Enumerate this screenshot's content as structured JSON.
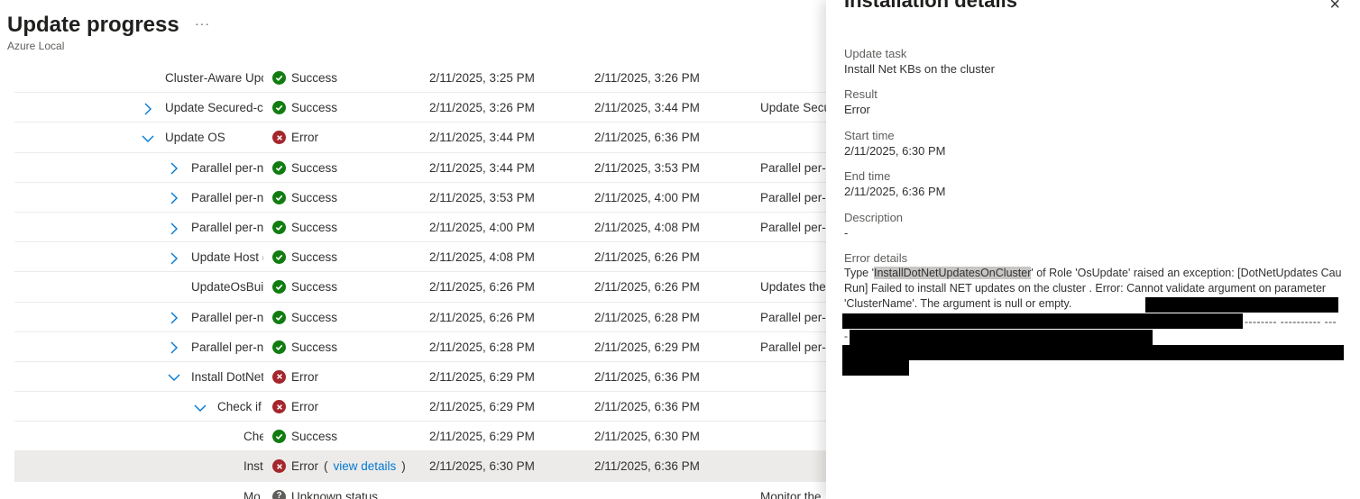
{
  "header": {
    "title": "Update progress",
    "subtitle": "Azure Local",
    "more": "···"
  },
  "rows": [
    {
      "chevron": "none",
      "indent": 0,
      "name": "Cluster-Aware Upc",
      "status": "success",
      "status_text": "Success",
      "start": "2/11/2025, 3:25 PM",
      "end": "2/11/2025, 3:26 PM",
      "desc": ""
    },
    {
      "chevron": "right",
      "indent": 0,
      "name": "Update Secured-cc",
      "status": "success",
      "status_text": "Success",
      "start": "2/11/2025, 3:26 PM",
      "end": "2/11/2025, 3:44 PM",
      "desc": "Update Secu"
    },
    {
      "chevron": "down",
      "indent": 0,
      "name": "Update OS",
      "status": "error",
      "status_text": "Error",
      "start": "2/11/2025, 3:44 PM",
      "end": "2/11/2025, 6:36 PM",
      "desc": ""
    },
    {
      "chevron": "right",
      "indent": 1,
      "name": "Parallel per-no",
      "status": "success",
      "status_text": "Success",
      "start": "2/11/2025, 3:44 PM",
      "end": "2/11/2025, 3:53 PM",
      "desc": "Parallel per-r"
    },
    {
      "chevron": "right",
      "indent": 1,
      "name": "Parallel per-no",
      "status": "success",
      "status_text": "Success",
      "start": "2/11/2025, 3:53 PM",
      "end": "2/11/2025, 4:00 PM",
      "desc": "Parallel per-r"
    },
    {
      "chevron": "right",
      "indent": 1,
      "name": "Parallel per-no",
      "status": "success",
      "status_text": "Success",
      "start": "2/11/2025, 4:00 PM",
      "end": "2/11/2025, 4:08 PM",
      "desc": "Parallel per-r"
    },
    {
      "chevron": "right",
      "indent": 1,
      "name": "Update Host (",
      "status": "success",
      "status_text": "Success",
      "start": "2/11/2025, 4:08 PM",
      "end": "2/11/2025, 6:26 PM",
      "desc": ""
    },
    {
      "chevron": "none",
      "indent": 1,
      "name": "UpdateOsBuil",
      "status": "success",
      "status_text": "Success",
      "start": "2/11/2025, 6:26 PM",
      "end": "2/11/2025, 6:26 PM",
      "desc": "Updates the"
    },
    {
      "chevron": "right",
      "indent": 1,
      "name": "Parallel per-no",
      "status": "success",
      "status_text": "Success",
      "start": "2/11/2025, 6:26 PM",
      "end": "2/11/2025, 6:28 PM",
      "desc": "Parallel per-r"
    },
    {
      "chevron": "right",
      "indent": 1,
      "name": "Parallel per-no",
      "status": "success",
      "status_text": "Success",
      "start": "2/11/2025, 6:28 PM",
      "end": "2/11/2025, 6:29 PM",
      "desc": "Parallel per-r"
    },
    {
      "chevron": "down",
      "indent": 1,
      "name": "Install DotNet",
      "status": "error",
      "status_text": "Error",
      "start": "2/11/2025, 6:29 PM",
      "end": "2/11/2025, 6:36 PM",
      "desc": ""
    },
    {
      "chevron": "down",
      "indent": 2,
      "name": "Check if",
      "status": "error",
      "status_text": "Error",
      "start": "2/11/2025, 6:29 PM",
      "end": "2/11/2025, 6:36 PM",
      "desc": ""
    },
    {
      "chevron": "none",
      "indent": 3,
      "name": "Che",
      "status": "success",
      "status_text": "Success",
      "start": "2/11/2025, 6:29 PM",
      "end": "2/11/2025, 6:30 PM",
      "desc": ""
    },
    {
      "chevron": "none",
      "indent": 3,
      "name": "Inst",
      "status": "error",
      "status_text": "Error",
      "link_open": "(",
      "link": "view details",
      "link_close": ")",
      "start": "2/11/2025, 6:30 PM",
      "end": "2/11/2025, 6:36 PM",
      "desc": "",
      "selected": true
    },
    {
      "chevron": "none",
      "indent": 3,
      "name": "Mo",
      "status": "unknown",
      "status_text": "Unknown status",
      "start": "",
      "end": "",
      "desc": "Monitor the"
    }
  ],
  "panel": {
    "title": "Installation details",
    "close": "×",
    "task_label": "Update task",
    "task_value": "Install Net KBs on the cluster",
    "result_label": "Result",
    "result_value": "Error",
    "start_label": "Start time",
    "start_value": "2/11/2025, 6:30 PM",
    "end_label": "End time",
    "end_value": "2/11/2025, 6:36 PM",
    "desc_label": "Description",
    "desc_value": "-",
    "err_label": "Error details",
    "err_pre": "Type '",
    "err_hl": "InstallDotNetUpdatesOnCluster",
    "err_post": "' of Role 'OsUpdate' raised an exception: [DotNetUpdates Cau Run] Failed to install NET updates on the cluster . Error: Cannot validate argument on parameter 'ClusterName'. The argument is null or empty.",
    "dash1": "-------- ---------- ---",
    "dash2": "-"
  }
}
